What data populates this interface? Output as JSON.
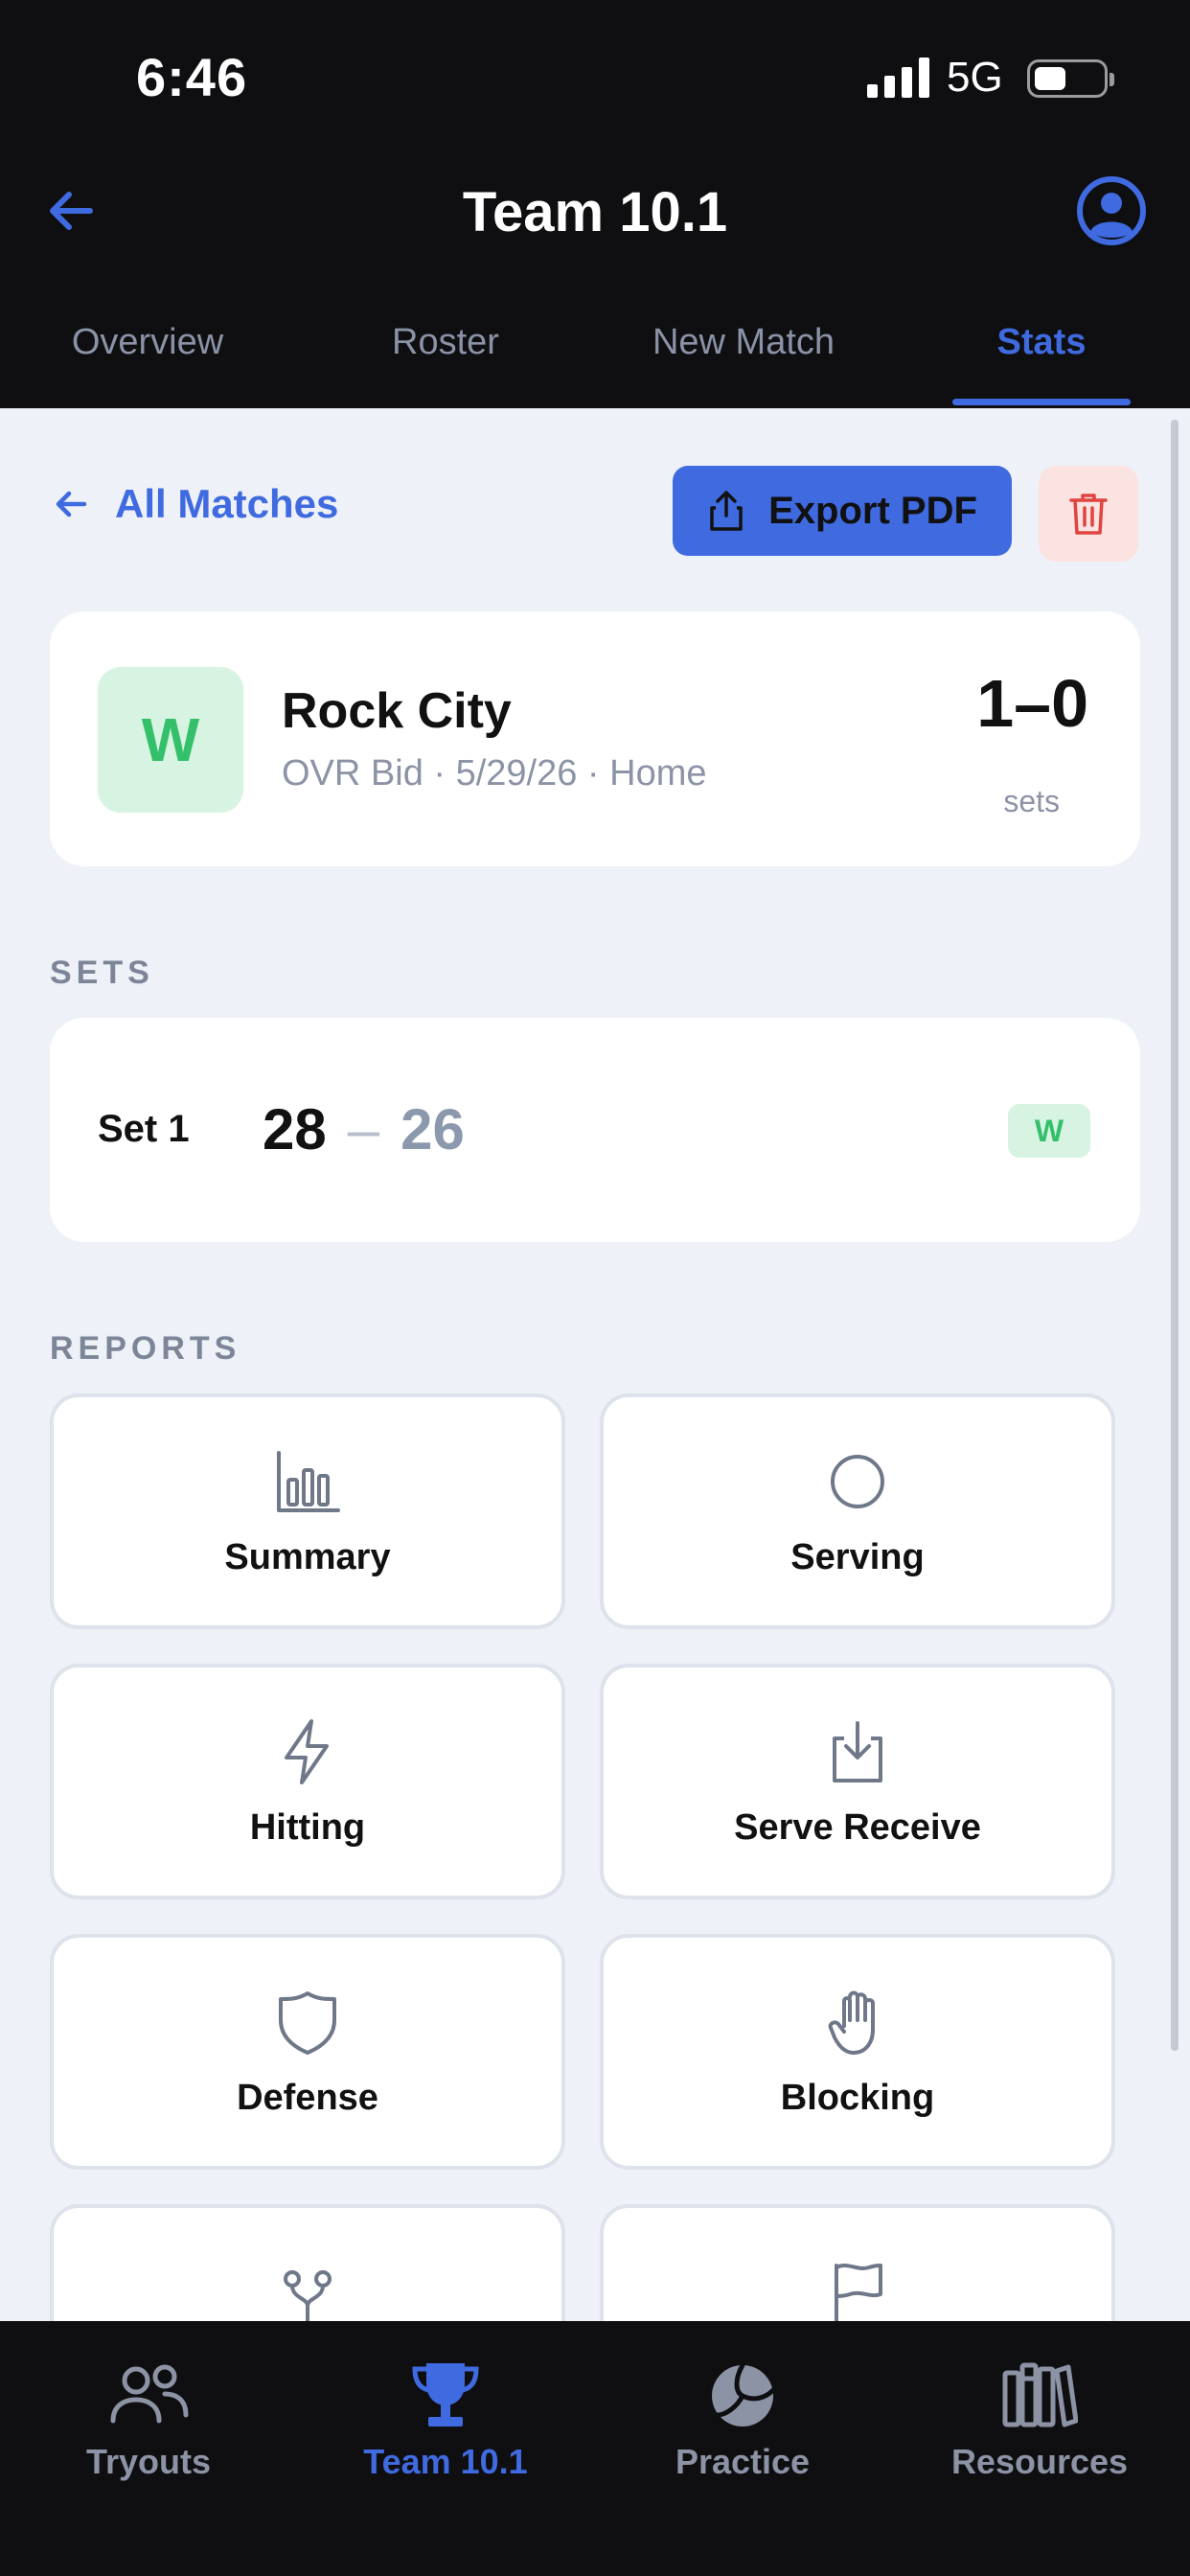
{
  "status_bar": {
    "time": "6:46",
    "network": "5G"
  },
  "navbar": {
    "title": "Team 10.1"
  },
  "tabs": [
    {
      "label": "Overview",
      "active": false
    },
    {
      "label": "Roster",
      "active": false
    },
    {
      "label": "New Match",
      "active": false
    },
    {
      "label": "Stats",
      "active": true
    }
  ],
  "actions": {
    "back_label": "All Matches",
    "export_label": "Export PDF"
  },
  "match": {
    "result": "W",
    "opponent": "Rock City",
    "meta": "OVR Bid · 5/29/26 · Home",
    "score": "1–0",
    "score_unit": "sets"
  },
  "sets_section": {
    "title": "SETS",
    "sets": [
      {
        "label": "Set 1",
        "ours": "28",
        "dash": "–",
        "theirs": "26",
        "result": "W"
      }
    ]
  },
  "reports_section": {
    "title": "REPORTS",
    "items": [
      {
        "label": "Summary",
        "icon": "bar-chart-icon"
      },
      {
        "label": "Serving",
        "icon": "circle-icon"
      },
      {
        "label": "Hitting",
        "icon": "lightning-icon"
      },
      {
        "label": "Serve Receive",
        "icon": "download-tray-icon"
      },
      {
        "label": "Defense",
        "icon": "shield-icon"
      },
      {
        "label": "Blocking",
        "icon": "hand-icon"
      },
      {
        "label": "",
        "icon": "branch-icon"
      },
      {
        "label": "",
        "icon": "flag-icon"
      }
    ]
  },
  "bottom_nav": [
    {
      "label": "Tryouts",
      "icon": "people-icon",
      "active": false
    },
    {
      "label": "Team 10.1",
      "icon": "trophy-icon",
      "active": true
    },
    {
      "label": "Practice",
      "icon": "volleyball-icon",
      "active": false
    },
    {
      "label": "Resources",
      "icon": "books-icon",
      "active": false
    }
  ],
  "colors": {
    "accent": "#3f6ae0",
    "win_green": "#34c06a",
    "win_green_bg": "#d7f3e1",
    "delete_bg": "#fbe3e2",
    "delete_icon": "#e0443e",
    "dark_bg": "#0f0f12",
    "page_bg": "#eef1f7"
  }
}
